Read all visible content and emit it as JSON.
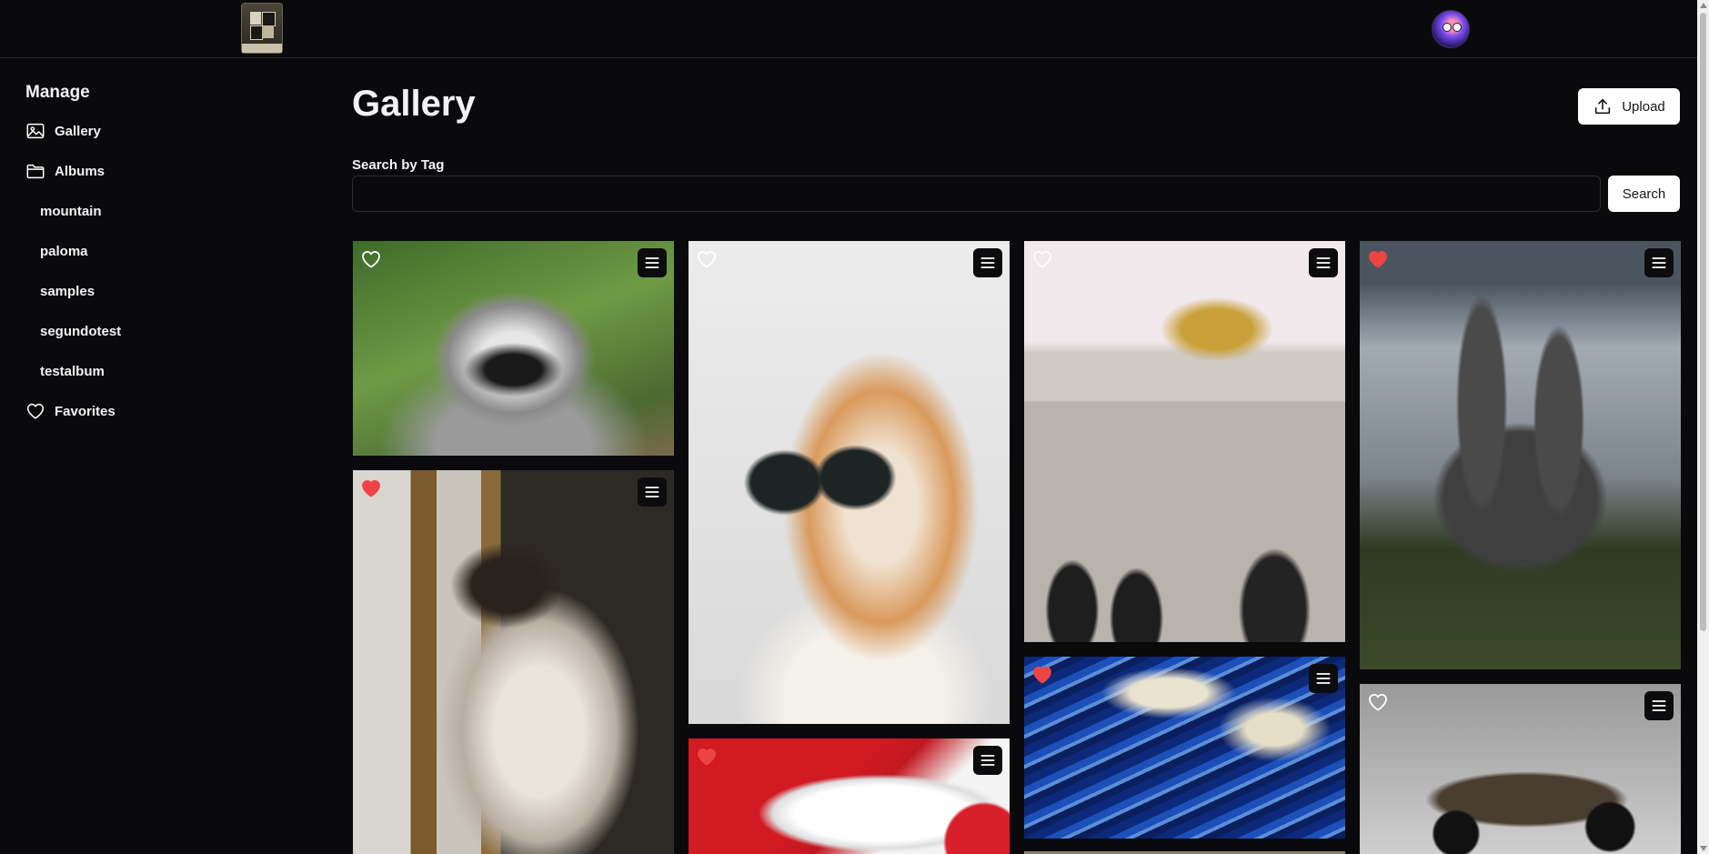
{
  "header": {
    "logo_icon": "photo-album-logo",
    "avatar_icon": "user-avatar"
  },
  "sidebar": {
    "heading": "Manage",
    "items": [
      {
        "label": "Gallery",
        "icon": "image-icon"
      },
      {
        "label": "Albums",
        "icon": "folder-icon"
      }
    ],
    "albums": [
      "mountain",
      "paloma",
      "samples",
      "segundotest",
      "testalbum"
    ],
    "favorites": {
      "label": "Favorites",
      "icon": "heart-icon"
    }
  },
  "main": {
    "title": "Gallery",
    "upload_label": "Upload",
    "search": {
      "label": "Search by Tag",
      "value": "",
      "placeholder": "",
      "button_label": "Search"
    }
  },
  "photos": [
    {
      "subject": "raccoon",
      "favorite": false
    },
    {
      "subject": "himalayan cat",
      "favorite": true
    },
    {
      "subject": "shiba dog with sunglasses",
      "favorite": false
    },
    {
      "subject": "santa hat with ornament",
      "favorite": true
    },
    {
      "subject": "monument arch with gold statues",
      "favorite": false
    },
    {
      "subject": "blue wave illustration",
      "favorite": true
    },
    {
      "subject": "gothic cathedral",
      "favorite": true
    },
    {
      "subject": "vintage car",
      "favorite": false
    }
  ],
  "colors": {
    "background": "#0a0a0c",
    "favorite_heart": "#ef4444",
    "button_bg": "#ffffff"
  }
}
